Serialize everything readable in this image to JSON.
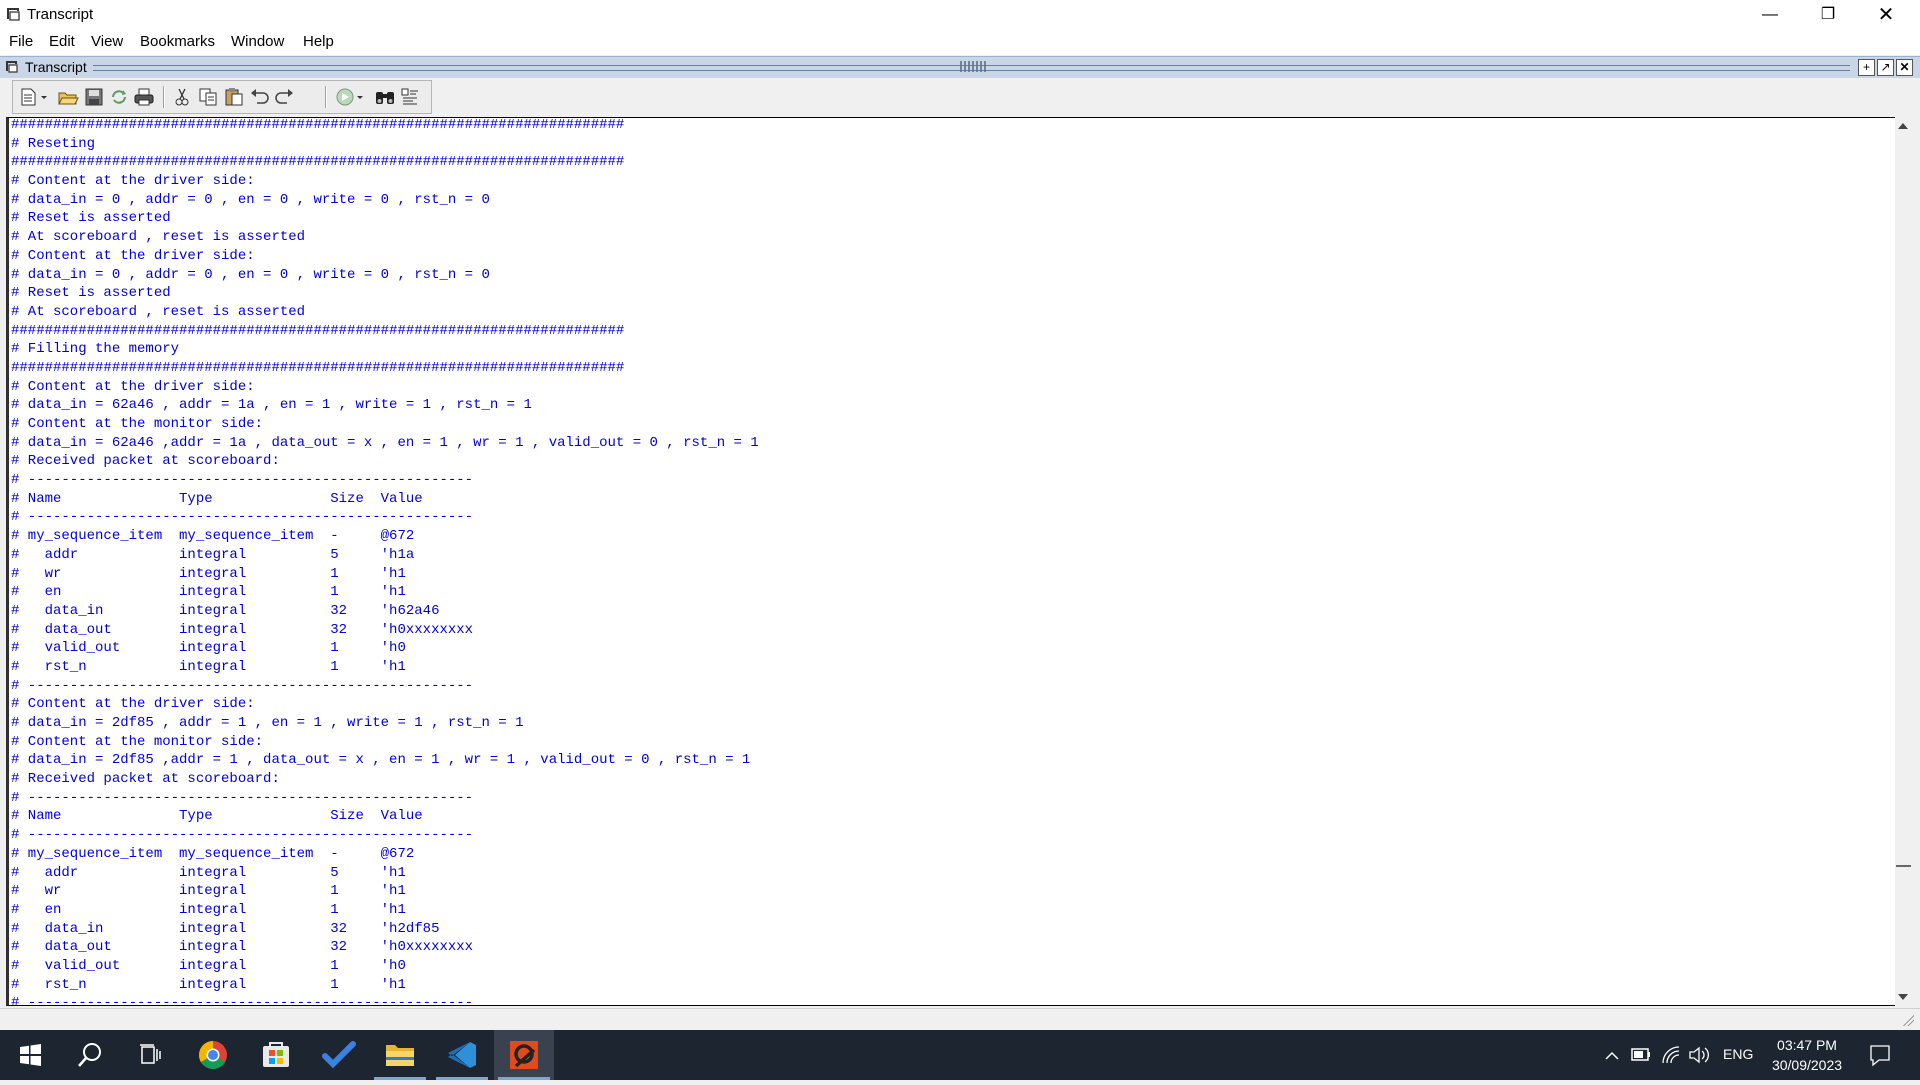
{
  "window": {
    "title": "Transcript",
    "minimize_glyph": "—",
    "restore_glyph": "❐",
    "close_glyph": "✕"
  },
  "menu": {
    "items": [
      "File",
      "Edit",
      "View",
      "Bookmarks",
      "Window",
      "Help"
    ]
  },
  "pane": {
    "title": "Transcript",
    "buttons": [
      "+",
      "↗",
      "✕"
    ]
  },
  "toolbar": {
    "icons": [
      "new-document-icon",
      "open-folder-icon",
      "save-icon",
      "reload-icon",
      "print-icon",
      "cut-icon",
      "copy-icon",
      "paste-icon",
      "undo-icon",
      "redo-icon",
      "run-icon",
      "find-icon",
      "format-icon"
    ]
  },
  "transcript": {
    "text_color": "#0000d8",
    "lines": [
      "#########################################################################",
      "# Reseting",
      "#########################################################################",
      "# Content at the driver side:",
      "# data_in = 0 , addr = 0 , en = 0 , write = 0 , rst_n = 0",
      "# Reset is asserted",
      "# At scoreboard , reset is asserted",
      "# Content at the driver side:",
      "# data_in = 0 , addr = 0 , en = 0 , write = 0 , rst_n = 0",
      "# Reset is asserted",
      "# At scoreboard , reset is asserted",
      "#########################################################################",
      "# Filling the memory",
      "#########################################################################",
      "# Content at the driver side:",
      "# data_in = 62a46 , addr = 1a , en = 1 , write = 1 , rst_n = 1",
      "# Content at the monitor side:",
      "# data_in = 62a46 ,addr = 1a , data_out = x , en = 1 , wr = 1 , valid_out = 0 , rst_n = 1",
      "# Received packet at scoreboard:",
      "# -----------------------------------------------------",
      "# Name              Type              Size  Value",
      "# -----------------------------------------------------",
      "# my_sequence_item  my_sequence_item  -     @672",
      "#   addr            integral          5     'h1a",
      "#   wr              integral          1     'h1",
      "#   en              integral          1     'h1",
      "#   data_in         integral          32    'h62a46",
      "#   data_out        integral          32    'h0xxxxxxxx",
      "#   valid_out       integral          1     'h0",
      "#   rst_n           integral          1     'h1",
      "# -----------------------------------------------------",
      "# Content at the driver side:",
      "# data_in = 2df85 , addr = 1 , en = 1 , write = 1 , rst_n = 1",
      "# Content at the monitor side:",
      "# data_in = 2df85 ,addr = 1 , data_out = x , en = 1 , wr = 1 , valid_out = 0 , rst_n = 1",
      "# Received packet at scoreboard:",
      "# -----------------------------------------------------",
      "# Name              Type              Size  Value",
      "# -----------------------------------------------------",
      "# my_sequence_item  my_sequence_item  -     @672",
      "#   addr            integral          5     'h1",
      "#   wr              integral          1     'h1",
      "#   en              integral          1     'h1",
      "#   data_in         integral          32    'h2df85",
      "#   data_out        integral          32    'h0xxxxxxxx",
      "#   valid_out       integral          1     'h0",
      "#   rst_n           integral          1     'h1",
      "# -----------------------------------------------------"
    ]
  },
  "taskbar": {
    "apps": [
      "start-icon",
      "search-icon",
      "task-view-icon",
      "chrome-icon",
      "store-icon",
      "todo-icon",
      "file-explorer-icon",
      "vscode-icon",
      "questa-icon"
    ],
    "language": "ENG",
    "time": "03:47 PM",
    "date": "30/09/2023"
  }
}
